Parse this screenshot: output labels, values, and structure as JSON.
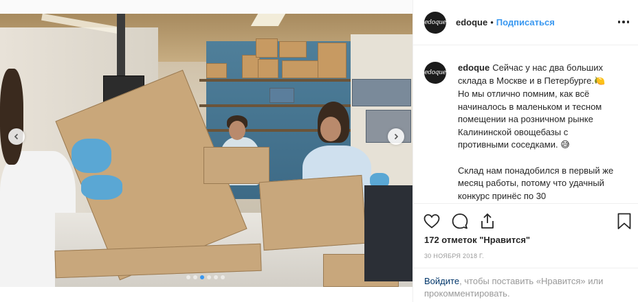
{
  "post": {
    "username": "edoque",
    "separator": "•",
    "follow_label": "Подписаться",
    "avatar_text": "edoque"
  },
  "caption": {
    "username": "edoque",
    "paragraph1": "Сейчас у нас два больших склада в Москве и в Петербурге.",
    "emoji1": "🍋",
    "paragraph1b": "Но мы отлично помним, как всё начиналось в маленьком и тесном помещении на розничном рынке Калининской овощебазы с противными соседками.",
    "emoji2": "😅",
    "paragraph2": "Склад нам понадобился в первый же месяц работы, потому что удачный конкурс принёс по 30"
  },
  "stats": {
    "likes": "172 отметок \"Нравится\"",
    "date": "30 НОЯБРЯ 2018 Г."
  },
  "login": {
    "link": "Войдите",
    "text": ", чтобы поставить «Нравится» или прокомментировать."
  },
  "carousel": {
    "total": 6,
    "active_index": 2
  },
  "colors": {
    "accent": "#3897f0",
    "link_dark": "#003569",
    "muted": "#999999",
    "text": "#262626"
  },
  "icons": {
    "more": "more-options-icon",
    "like": "heart-icon",
    "comment": "comment-icon",
    "share": "share-icon",
    "save": "bookmark-icon",
    "prev": "chevron-left-icon",
    "next": "chevron-right-icon"
  }
}
